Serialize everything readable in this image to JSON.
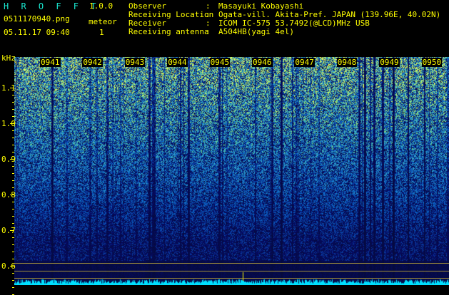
{
  "app": {
    "name": "H R O F F T",
    "version": "1.0.0"
  },
  "file": {
    "name": "0511170940.png",
    "datetime": "05.11.17 09:40"
  },
  "meteor": {
    "label": "meteor",
    "count": "1"
  },
  "header": {
    "rows": [
      {
        "key": "Observer",
        "colon": ":",
        "value": "Masayuki Kobayashi"
      },
      {
        "key": "Receiving Location",
        "colon": ":",
        "value": "Ogata-vill. Akita-Pref. JAPAN (139.96E, 40.02N)"
      },
      {
        "key": "Receiver",
        "colon": ":",
        "value": "ICOM IC-575 53.7492(@LCD)MHz USB"
      },
      {
        "key": "Receiving antenna",
        "colon": ":",
        "value": "A504HB(yagi 4el)"
      }
    ]
  },
  "spectrogram": {
    "y_unit": "kHz",
    "y_ticks": [
      "1.1",
      "1.0",
      "0.9",
      "0.8",
      "0.7",
      "0.6"
    ],
    "time_ticks": [
      "0941",
      "0942",
      "0943",
      "0944",
      "0945",
      "0946",
      "0947",
      "0948",
      "0949",
      "0950"
    ],
    "colors": {
      "background": "#000000",
      "text": "#ffff00",
      "app_name": "#19e8d0",
      "baseline": "#00e0ff"
    }
  }
}
